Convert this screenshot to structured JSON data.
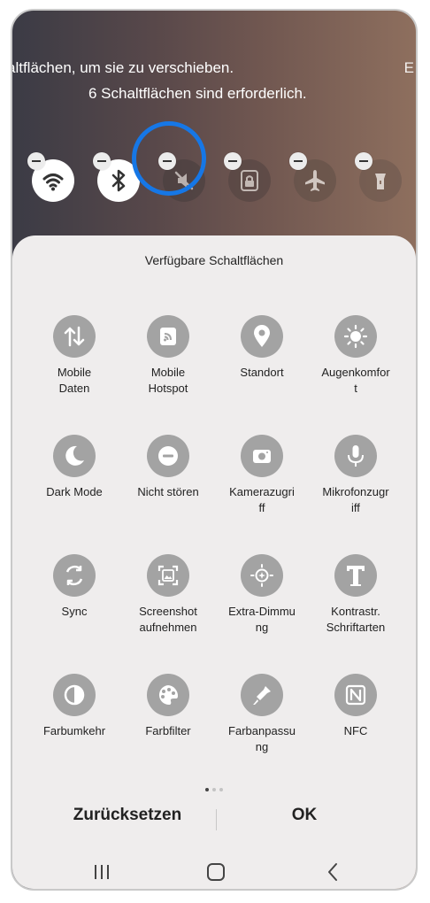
{
  "instructions": {
    "line1": "altflächen, um sie zu verschieben.",
    "line1_edge": "E",
    "line2": "6 Schaltflächen sind erforderlich."
  },
  "active_buttons": [
    {
      "icon": "wifi-icon",
      "enabled": true
    },
    {
      "icon": "bluetooth-icon",
      "enabled": true
    },
    {
      "icon": "mute-icon",
      "enabled": false,
      "highlighted": true
    },
    {
      "icon": "lock-rotation-icon",
      "enabled": false
    },
    {
      "icon": "airplane-icon",
      "enabled": false
    },
    {
      "icon": "flashlight-icon",
      "enabled": false
    }
  ],
  "panel": {
    "title": "Verfügbare Schaltflächen",
    "items": [
      {
        "label": "Mobile\nDaten",
        "icon": "mobile-data-icon"
      },
      {
        "label": "Mobile\nHotspot",
        "icon": "hotspot-icon"
      },
      {
        "label": "Standort",
        "icon": "location-icon"
      },
      {
        "label": "Augenkomfor\nt",
        "icon": "eye-comfort-icon"
      },
      {
        "label": "Dark Mode",
        "icon": "dark-mode-icon"
      },
      {
        "label": "Nicht stören",
        "icon": "do-not-disturb-icon"
      },
      {
        "label": "Kamerazugri\nff",
        "icon": "camera-access-icon"
      },
      {
        "label": "Mikrofonzugr\niff",
        "icon": "microphone-access-icon"
      },
      {
        "label": "Sync",
        "icon": "sync-icon"
      },
      {
        "label": "Screenshot\naufnehmen",
        "icon": "screenshot-icon"
      },
      {
        "label": "Extra-Dimmu\nng",
        "icon": "extra-dim-icon"
      },
      {
        "label": "Kontrastr.\nSchriftarten",
        "icon": "contrast-font-icon"
      },
      {
        "label": "Farbumkehr",
        "icon": "color-inversion-icon"
      },
      {
        "label": "Farbfilter",
        "icon": "color-filter-icon"
      },
      {
        "label": "Farbanpassu\nng",
        "icon": "color-adjust-icon"
      },
      {
        "label": "NFC",
        "icon": "nfc-icon"
      }
    ],
    "page_indicator": {
      "pages": 3,
      "current": 1
    },
    "reset_label": "Zurücksetzen",
    "ok_label": "OK"
  },
  "navbar": {
    "recents": "recents-icon",
    "home": "home-icon",
    "back": "back-icon"
  }
}
